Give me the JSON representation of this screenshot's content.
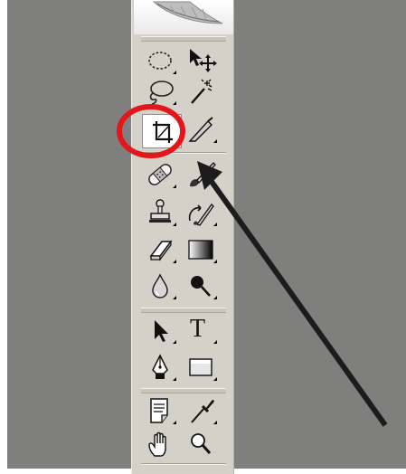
{
  "colors": {
    "canvas_background": "#7f7f7e",
    "toolbar_background": "#d3d1c8",
    "highlight_circle": "#e3161c",
    "annotation_arrow": "#1c1c1c"
  },
  "toolbar": {
    "header_icon": "feather-icon",
    "tools": [
      {
        "id": "marquee",
        "icon": "elliptical-marquee-icon"
      },
      {
        "id": "move",
        "icon": "move-icon"
      },
      {
        "id": "lasso",
        "icon": "lasso-icon"
      },
      {
        "id": "magic-wand",
        "icon": "magic-wand-icon"
      },
      {
        "id": "crop",
        "icon": "crop-icon",
        "selected": true
      },
      {
        "id": "slice",
        "icon": "slice-icon"
      },
      {
        "id": "healing",
        "icon": "healing-brush-icon"
      },
      {
        "id": "brush",
        "icon": "brush-icon"
      },
      {
        "id": "stamp",
        "icon": "clone-stamp-icon"
      },
      {
        "id": "history-brush",
        "icon": "history-brush-icon"
      },
      {
        "id": "eraser",
        "icon": "eraser-icon"
      },
      {
        "id": "gradient",
        "icon": "gradient-icon"
      },
      {
        "id": "blur",
        "icon": "blur-icon"
      },
      {
        "id": "dodge",
        "icon": "dodge-icon"
      },
      {
        "id": "path-selection",
        "icon": "path-selection-icon"
      },
      {
        "id": "type",
        "icon": "type-icon",
        "glyph": "T"
      },
      {
        "id": "pen",
        "icon": "pen-icon"
      },
      {
        "id": "shape",
        "icon": "rectangle-shape-icon"
      },
      {
        "id": "notes",
        "icon": "notes-icon"
      },
      {
        "id": "eyedropper",
        "icon": "eyedropper-icon"
      },
      {
        "id": "hand",
        "icon": "hand-icon"
      },
      {
        "id": "zoom",
        "icon": "zoom-icon"
      }
    ]
  },
  "annotations": {
    "highlight": "red-circle-around-crop-tool",
    "arrow": "arrow-pointing-to-slice-tool"
  }
}
